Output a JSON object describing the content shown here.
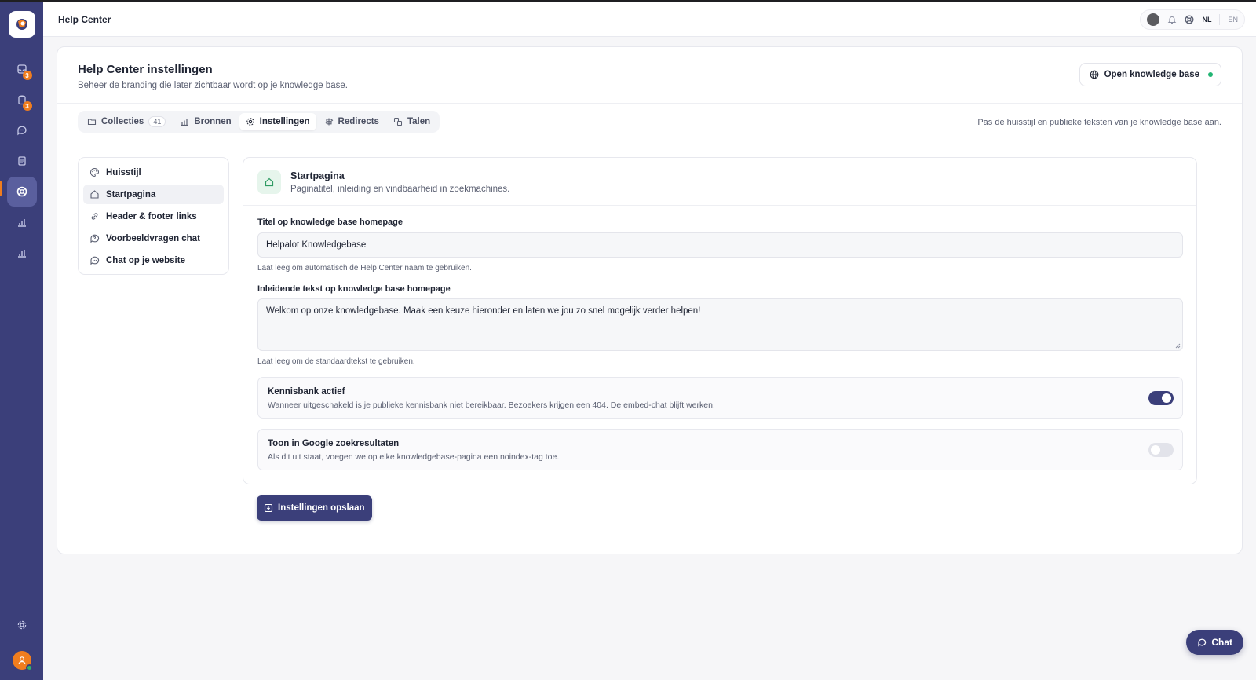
{
  "topbar": {
    "title": "Help Center",
    "lang_nl": "NL",
    "lang_en": "EN"
  },
  "sidebar": {
    "items": [
      {
        "icon": "inbox-icon",
        "badge": "3"
      },
      {
        "icon": "clipboard-icon",
        "badge": "3"
      },
      {
        "icon": "chat-bubble-icon"
      },
      {
        "icon": "document-icon"
      },
      {
        "icon": "lifebuoy-icon",
        "active": true
      },
      {
        "icon": "bar-chart-icon"
      },
      {
        "icon": "bar-chart-icon"
      }
    ]
  },
  "header": {
    "title": "Help Center instellingen",
    "subtitle": "Beheer de branding die later zichtbaar wordt op je knowledge base.",
    "open_kb_label": "Open knowledge base"
  },
  "tabs": [
    {
      "label": "Collecties",
      "count": "41"
    },
    {
      "label": "Bronnen"
    },
    {
      "label": "Instellingen",
      "active": true
    },
    {
      "label": "Redirects"
    },
    {
      "label": "Talen"
    }
  ],
  "tabs_hint": "Pas de huisstijl en publieke teksten van je knowledge base aan.",
  "settings_nav": [
    {
      "label": "Huisstijl",
      "icon": "palette-icon"
    },
    {
      "label": "Startpagina",
      "icon": "home-icon",
      "active": true
    },
    {
      "label": "Header & footer links",
      "icon": "link-icon"
    },
    {
      "label": "Voorbeeldvragen chat",
      "icon": "chat-question-icon"
    },
    {
      "label": "Chat op je website",
      "icon": "chat-dots-icon"
    }
  ],
  "panel": {
    "title": "Startpagina",
    "subtitle": "Paginatitel, inleiding en vindbaarheid in zoekmachines."
  },
  "form": {
    "title_label": "Titel op knowledge base homepage",
    "title_value": "Helpalot Knowledgebase",
    "title_help": "Laat leeg om automatisch de Help Center naam te gebruiken.",
    "intro_label": "Inleidende tekst op knowledge base homepage",
    "intro_value": "Welkom op onze knowledgebase. Maak een keuze hieronder en laten we jou zo snel mogelijk verder helpen!",
    "intro_help": "Laat leeg om de standaardtekst te gebruiken."
  },
  "toggles": [
    {
      "title": "Kennisbank actief",
      "description": "Wanneer uitgeschakeld is je publieke kennisbank niet bereikbaar. Bezoekers krijgen een 404. De embed-chat blijft werken.",
      "on": true
    },
    {
      "title": "Toon in Google zoekresultaten",
      "description": "Als dit uit staat, voegen we op elke knowledgebase-pagina een noindex-tag toe.",
      "on": false
    }
  ],
  "save_label": "Instellingen opslaan",
  "chat_label": "Chat",
  "colors": {
    "sidebar": "#3b3f7a",
    "accent": "#f07d1e",
    "success": "#22b573"
  }
}
